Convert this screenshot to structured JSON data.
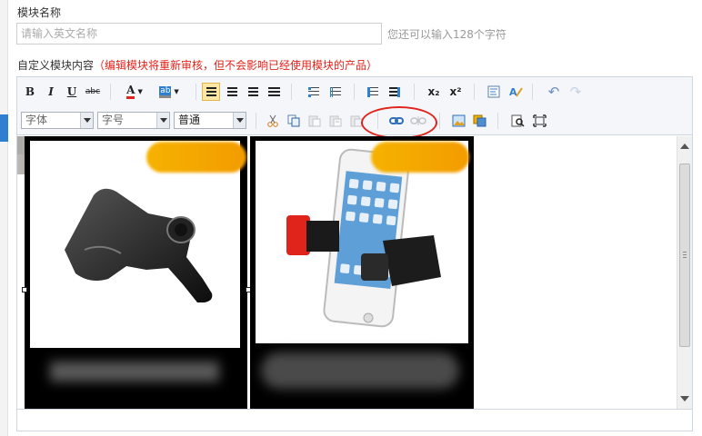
{
  "module_name": {
    "label": "模块名称",
    "placeholder": "请输入英文名称",
    "hint": "您还可以输入128个字符"
  },
  "content": {
    "label": "自定义模块内容",
    "warning": "（编辑模块将重新审核，但不会影响已经使用模块的产品）"
  },
  "toolbar": {
    "bold": "B",
    "italic": "I",
    "underline": "U",
    "strikethrough": "abc",
    "font_color": "A",
    "highlight": "ab",
    "subscript": "x₂",
    "superscript": "x²",
    "font_family_placeholder": "字体",
    "font_size_placeholder": "字号",
    "format_value": "普通"
  },
  "colors": {
    "accent": "#2f7fd1",
    "warning": "#e0231b",
    "badge": "#f6b200"
  }
}
